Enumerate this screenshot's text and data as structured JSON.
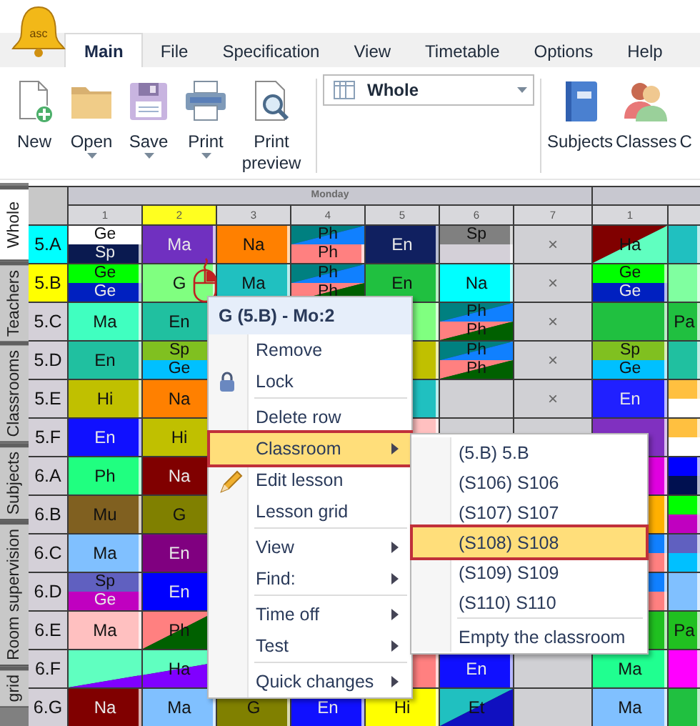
{
  "logo": {
    "text": "asc"
  },
  "menu_tabs": [
    {
      "label": "Main",
      "selected": true
    },
    {
      "label": "File",
      "selected": false
    },
    {
      "label": "Specification",
      "selected": false
    },
    {
      "label": "View",
      "selected": false
    },
    {
      "label": "Timetable",
      "selected": false
    },
    {
      "label": "Options",
      "selected": false
    },
    {
      "label": "Help",
      "selected": false
    }
  ],
  "toolbar": {
    "buttons": [
      {
        "kind": "new",
        "label": "New"
      },
      {
        "kind": "open",
        "label": "Open",
        "dropdown": true
      },
      {
        "kind": "save",
        "label": "Save",
        "dropdown": true
      },
      {
        "kind": "print",
        "label": "Print",
        "dropdown": true
      },
      {
        "kind": "preview",
        "label": "Print preview"
      }
    ],
    "view_select": {
      "value": "Whole"
    },
    "right_buttons": [
      {
        "kind": "subjects",
        "label": "Subjects"
      },
      {
        "kind": "classes",
        "label": "Classes"
      },
      {
        "kind": "cut",
        "label": "C"
      }
    ]
  },
  "side_tabs": [
    {
      "label": "Whole",
      "selected": true
    },
    {
      "label": "Teachers",
      "selected": false
    },
    {
      "label": "Classrooms",
      "selected": false
    },
    {
      "label": "Subjects",
      "selected": false
    },
    {
      "label": "Room supervision",
      "selected": false
    },
    {
      "label": "grid",
      "selected": false
    }
  ],
  "timetable": {
    "day": "Monday",
    "periods": [
      {
        "label": "1",
        "selected": false
      },
      {
        "label": "2",
        "selected": true
      },
      {
        "label": "3",
        "selected": false
      },
      {
        "label": "4",
        "selected": false
      },
      {
        "label": "5",
        "selected": false
      },
      {
        "label": "6",
        "selected": false
      },
      {
        "label": "7",
        "selected": false
      }
    ],
    "next_day_periods": [
      {
        "label": "1",
        "selected": false
      }
    ],
    "rows": [
      {
        "label": "5.A",
        "color": "#00ffff",
        "cells": [
          {
            "kind": "split",
            "parts": [
              {
                "kind": "lesson",
                "text": "Ge",
                "color": "#ffffff"
              },
              {
                "kind": "lesson",
                "text": "Sp",
                "color": "#0a1a50"
              }
            ]
          },
          {
            "kind": "lesson",
            "text": "Ma",
            "color": "#7030c0"
          },
          {
            "kind": "lesson",
            "text": "Na",
            "color": "#ff8000"
          },
          {
            "kind": "split",
            "parts": [
              {
                "kind": "diagonal",
                "text": "Ph",
                "parts": [
                  {
                    "color": "#008080"
                  },
                  {
                    "color": "#1080ff"
                  }
                ]
              },
              {
                "kind": "lesson",
                "text": "Ph",
                "color": "#ff8080"
              }
            ]
          },
          {
            "kind": "lesson",
            "text": "En",
            "color": "#102060"
          },
          {
            "kind": "split",
            "parts": [
              {
                "kind": "lesson",
                "text": "Sp",
                "color": "#808080"
              },
              {
                "kind": "lesson",
                "color": "#d4d0d8"
              }
            ]
          },
          {
            "kind": "free",
            "text": "×"
          },
          {
            "kind": "diagonal",
            "text": "Ha",
            "parts": [
              {
                "color": "#800000"
              },
              {
                "color": "#60ffc0"
              }
            ]
          },
          {
            "kind": "lesson",
            "color": "#20c0c0"
          }
        ]
      },
      {
        "label": "5.B",
        "color": "#ffff00",
        "cells": [
          {
            "kind": "split",
            "parts": [
              {
                "kind": "lesson",
                "text": "Ge",
                "color": "#00ff00"
              },
              {
                "kind": "lesson",
                "text": "Ge",
                "color": "#0020c0"
              }
            ]
          },
          {
            "kind": "lesson",
            "text": "G",
            "color": "#80ff80",
            "cursor": true
          },
          {
            "kind": "lesson",
            "text": "Ma",
            "color": "#20c0c0"
          },
          {
            "kind": "split",
            "parts": [
              {
                "kind": "diagonal",
                "text": "Ph",
                "parts": [
                  {
                    "color": "#008080"
                  },
                  {
                    "color": "#1080ff"
                  }
                ]
              },
              {
                "kind": "diagonal",
                "text": "Ph",
                "parts": [
                  {
                    "color": "#ff8080"
                  },
                  {
                    "color": "#006000"
                  }
                ]
              }
            ]
          },
          {
            "kind": "lesson",
            "text": "En",
            "color": "#20c040"
          },
          {
            "kind": "lesson",
            "text": "Na",
            "color": "#00ffff"
          },
          {
            "kind": "free",
            "text": "×"
          },
          {
            "kind": "split",
            "parts": [
              {
                "kind": "lesson",
                "text": "Ge",
                "color": "#00ff00"
              },
              {
                "kind": "lesson",
                "text": "Ge",
                "color": "#0020c0"
              }
            ]
          },
          {
            "kind": "lesson",
            "color": "#80ffa0"
          }
        ]
      },
      {
        "label": "5.C",
        "color": "#d4d0d8",
        "cells": [
          {
            "kind": "lesson",
            "text": "Ma",
            "color": "#40ffc0"
          },
          {
            "kind": "lesson",
            "text": "En",
            "color": "#20c0a0"
          },
          {
            "kind": "hidden"
          },
          {
            "kind": "hidden"
          },
          {
            "kind": "lesson",
            "color": "#80ff80"
          },
          {
            "kind": "split",
            "parts": [
              {
                "kind": "diagonal",
                "text": "Ph",
                "parts": [
                  {
                    "color": "#008080"
                  },
                  {
                    "color": "#1080ff"
                  }
                ]
              },
              {
                "kind": "diagonal",
                "text": "Ph",
                "parts": [
                  {
                    "color": "#ff8080"
                  },
                  {
                    "color": "#006000"
                  }
                ]
              }
            ]
          },
          {
            "kind": "free",
            "text": "×"
          },
          {
            "kind": "lesson",
            "color": "#20c040"
          },
          {
            "kind": "lesson",
            "text": "Pa",
            "color": "#20c040"
          }
        ]
      },
      {
        "label": "5.D",
        "color": "#d4d0d8",
        "cells": [
          {
            "kind": "lesson",
            "text": "En",
            "color": "#20c0a0"
          },
          {
            "kind": "split",
            "parts": [
              {
                "kind": "lesson",
                "text": "Sp",
                "color": "#80c020"
              },
              {
                "kind": "lesson",
                "text": "Ge",
                "color": "#00c0ff"
              }
            ]
          },
          {
            "kind": "hidden"
          },
          {
            "kind": "hidden"
          },
          {
            "kind": "lesson",
            "color": "#c0c000"
          },
          {
            "kind": "split",
            "parts": [
              {
                "kind": "diagonal",
                "text": "Ph",
                "parts": [
                  {
                    "color": "#008080"
                  },
                  {
                    "color": "#1080ff"
                  }
                ]
              },
              {
                "kind": "diagonal",
                "text": "Ph",
                "parts": [
                  {
                    "color": "#ff8080"
                  },
                  {
                    "color": "#006000"
                  }
                ]
              }
            ]
          },
          {
            "kind": "free",
            "text": "×"
          },
          {
            "kind": "split",
            "parts": [
              {
                "kind": "lesson",
                "text": "Sp",
                "color": "#80c020"
              },
              {
                "kind": "lesson",
                "text": "Ge",
                "color": "#00c0ff"
              }
            ]
          },
          {
            "kind": "lesson",
            "color": "#20c0a0"
          }
        ]
      },
      {
        "label": "5.E",
        "color": "#d4d0d8",
        "cells": [
          {
            "kind": "lesson",
            "text": "Hi",
            "color": "#c0c000"
          },
          {
            "kind": "lesson",
            "text": "Na",
            "color": "#ff8000"
          },
          {
            "kind": "hidden"
          },
          {
            "kind": "hidden"
          },
          {
            "kind": "lesson",
            "color": "#20c0c0"
          },
          {
            "kind": "empty"
          },
          {
            "kind": "free",
            "text": "×"
          },
          {
            "kind": "lesson",
            "text": "En",
            "color": "#2020ff"
          },
          {
            "kind": "split",
            "parts": [
              {
                "kind": "lesson",
                "color": "#ffc040"
              },
              {
                "kind": "lesson",
                "color": "#ffffff"
              }
            ]
          }
        ]
      },
      {
        "label": "5.F",
        "color": "#d4d0d8",
        "cells": [
          {
            "kind": "lesson",
            "text": "En",
            "color": "#1010ff"
          },
          {
            "kind": "lesson",
            "text": "Hi",
            "color": "#c0c000"
          },
          {
            "kind": "hidden"
          },
          {
            "kind": "hidden"
          },
          {
            "kind": "lesson",
            "color": "#ffc0c0"
          },
          {
            "kind": "empty"
          },
          {
            "kind": "empty"
          },
          {
            "kind": "lesson",
            "color": "#8030c0"
          },
          {
            "kind": "split",
            "parts": [
              {
                "kind": "lesson",
                "color": "#ffc040"
              },
              {
                "kind": "lesson",
                "color": "#ffffff"
              }
            ]
          }
        ]
      },
      {
        "label": "6.A",
        "color": "#d4d0d8",
        "cells": [
          {
            "kind": "lesson",
            "text": "Ph",
            "color": "#20ff80"
          },
          {
            "kind": "lesson",
            "text": "Na",
            "color": "#800000"
          },
          {
            "kind": "hidden"
          },
          {
            "kind": "hidden"
          },
          {
            "kind": "hidden"
          },
          {
            "kind": "hidden"
          },
          {
            "kind": "hidden"
          },
          {
            "kind": "lesson",
            "color": "#e000e0"
          },
          {
            "kind": "split",
            "parts": [
              {
                "kind": "lesson",
                "color": "#0000ff"
              },
              {
                "kind": "lesson",
                "color": "#001050"
              }
            ]
          }
        ]
      },
      {
        "label": "6.B",
        "color": "#d4d0d8",
        "cells": [
          {
            "kind": "lesson",
            "text": "Mu",
            "color": "#806020"
          },
          {
            "kind": "lesson",
            "text": "G",
            "color": "#808000"
          },
          {
            "kind": "hidden"
          },
          {
            "kind": "hidden"
          },
          {
            "kind": "hidden"
          },
          {
            "kind": "hidden"
          },
          {
            "kind": "hidden"
          },
          {
            "kind": "lesson",
            "color": "#ffb000"
          },
          {
            "kind": "split",
            "parts": [
              {
                "kind": "lesson",
                "color": "#00ff00"
              },
              {
                "kind": "lesson",
                "color": "#c000c0"
              }
            ]
          }
        ]
      },
      {
        "label": "6.C",
        "color": "#d4d0d8",
        "cells": [
          {
            "kind": "lesson",
            "text": "Ma",
            "color": "#80c0ff"
          },
          {
            "kind": "lesson",
            "text": "En",
            "color": "#800080"
          },
          {
            "kind": "hidden"
          },
          {
            "kind": "hidden"
          },
          {
            "kind": "hidden"
          },
          {
            "kind": "hidden"
          },
          {
            "kind": "hidden"
          },
          {
            "kind": "split",
            "parts": [
              {
                "kind": "lesson",
                "color": "#1080ff"
              },
              {
                "kind": "lesson",
                "color": "#ff8080"
              }
            ]
          },
          {
            "kind": "split",
            "parts": [
              {
                "kind": "lesson",
                "color": "#6060c0"
              },
              {
                "kind": "lesson",
                "color": "#00c0ff"
              }
            ]
          }
        ]
      },
      {
        "label": "6.D",
        "color": "#d4d0d8",
        "cells": [
          {
            "kind": "split",
            "parts": [
              {
                "kind": "lesson",
                "text": "Sp",
                "color": "#6060c0"
              },
              {
                "kind": "lesson",
                "text": "Ge",
                "color": "#c000c0"
              }
            ]
          },
          {
            "kind": "lesson",
            "text": "En",
            "color": "#0000ff"
          },
          {
            "kind": "hidden"
          },
          {
            "kind": "hidden"
          },
          {
            "kind": "hidden"
          },
          {
            "kind": "hidden"
          },
          {
            "kind": "hidden"
          },
          {
            "kind": "split",
            "parts": [
              {
                "kind": "lesson",
                "color": "#1080ff"
              },
              {
                "kind": "lesson",
                "color": "#ff8080"
              }
            ]
          },
          {
            "kind": "lesson",
            "color": "#80c0ff"
          }
        ]
      },
      {
        "label": "6.E",
        "color": "#d4d0d8",
        "cells": [
          {
            "kind": "lesson",
            "text": "Ma",
            "color": "#ffc0c0"
          },
          {
            "kind": "diagonal",
            "text": "Ph",
            "parts": [
              {
                "color": "#ff8080"
              },
              {
                "color": "#006000"
              }
            ]
          },
          {
            "kind": "hidden"
          },
          {
            "kind": "hidden"
          },
          {
            "kind": "hidden"
          },
          {
            "kind": "hidden"
          },
          {
            "kind": "hidden"
          },
          {
            "kind": "lesson",
            "color": "#20c020"
          },
          {
            "kind": "lesson",
            "text": "Pa",
            "color": "#20c020"
          }
        ]
      },
      {
        "label": "6.F",
        "color": "#d4d0d8",
        "cells": [
          {
            "kind": "diagonal_first",
            "parts": [
              {
                "color": "#60ffc0"
              },
              {
                "color": "#8000ff"
              }
            ]
          },
          {
            "kind": "diagonal_middle",
            "text": "Ha",
            "parts": [
              {
                "color": "#60ffc0"
              },
              {
                "color": "#8000ff"
              }
            ]
          },
          {
            "kind": "hidden"
          },
          {
            "kind": "hidden"
          },
          {
            "kind": "lesson",
            "color": "#ff8080"
          },
          {
            "kind": "lesson",
            "text": "En",
            "color": "#1010ff"
          },
          {
            "kind": "empty"
          },
          {
            "kind": "lesson",
            "text": "Ma",
            "color": "#20ff90"
          },
          {
            "kind": "lesson",
            "color": "#ff00ff"
          }
        ]
      },
      {
        "label": "6.G",
        "color": "#d4d0d8",
        "cells": [
          {
            "kind": "lesson",
            "text": "Na",
            "color": "#800000"
          },
          {
            "kind": "lesson",
            "text": "Ma",
            "color": "#80c0ff"
          },
          {
            "kind": "lesson",
            "text": "G",
            "color": "#808000"
          },
          {
            "kind": "lesson",
            "text": "En",
            "color": "#1010ff"
          },
          {
            "kind": "lesson",
            "text": "Hi",
            "color": "#ffff00"
          },
          {
            "kind": "diagonal",
            "text": "Et",
            "parts": [
              {
                "color": "#20c0c0"
              },
              {
                "color": "#1010c0"
              }
            ]
          },
          {
            "kind": "empty"
          },
          {
            "kind": "lesson",
            "text": "Ma",
            "color": "#80c0ff"
          },
          {
            "kind": "lesson",
            "color": "#20c040"
          }
        ]
      }
    ]
  },
  "context_menu": {
    "title": "G (5.B) - Mo:2",
    "items": [
      {
        "kind": "item",
        "label": "Remove",
        "selected": false
      },
      {
        "kind": "lock",
        "label": "Lock",
        "selected": false
      },
      {
        "kind": "separator"
      },
      {
        "kind": "item",
        "label": "Delete row",
        "selected": false
      },
      {
        "kind": "item",
        "label": "Classroom",
        "submenu": true,
        "selected": true
      },
      {
        "kind": "edit",
        "label": "Edit lesson",
        "selected": false
      },
      {
        "kind": "item",
        "label": "Lesson grid",
        "selected": false
      },
      {
        "kind": "separator"
      },
      {
        "kind": "item",
        "label": "View",
        "submenu": true,
        "selected": false
      },
      {
        "kind": "item",
        "label": "Find:",
        "submenu": true,
        "selected": false
      },
      {
        "kind": "separator"
      },
      {
        "kind": "item",
        "label": "Time off",
        "submenu": true,
        "selected": false
      },
      {
        "kind": "item",
        "label": "Test",
        "submenu": true,
        "selected": false
      },
      {
        "kind": "separator"
      },
      {
        "kind": "item",
        "label": "Quick changes",
        "submenu": true,
        "selected": false
      }
    ]
  },
  "classroom_submenu": {
    "items": [
      {
        "kind": "item",
        "label": "(5.B) 5.B",
        "selected": false
      },
      {
        "kind": "item",
        "label": "(S106) S106",
        "selected": false
      },
      {
        "kind": "item",
        "label": "(S107) S107",
        "selected": false
      },
      {
        "kind": "item",
        "label": "(S108) S108",
        "selected": true
      },
      {
        "kind": "item",
        "label": "(S109) S109",
        "selected": false
      },
      {
        "kind": "item",
        "label": "(S110) S110",
        "selected": false
      },
      {
        "kind": "separator"
      },
      {
        "kind": "item",
        "label": "Empty the classroom",
        "selected": false
      }
    ]
  }
}
